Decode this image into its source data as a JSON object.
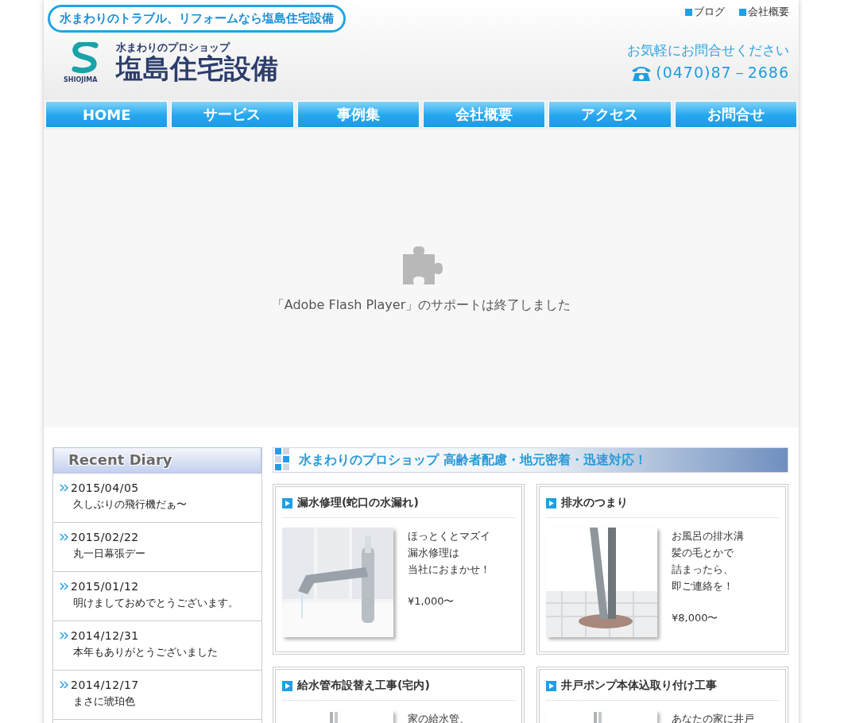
{
  "header": {
    "tagline": "水まわりのトラブル、リフォームなら塩島住宅設備",
    "logo": {
      "sub": "水まわりのプロショップ",
      "name": "塩島住宅設備",
      "roman": "SHIOJIMA"
    },
    "top_links": [
      "ブログ",
      "会社概要"
    ],
    "contact": {
      "prompt": "お気軽にお問合せください",
      "phone": "(0470)87－2686"
    }
  },
  "nav": [
    "HOME",
    "サービス",
    "事例集",
    "会社概要",
    "アクセス",
    "お問合せ"
  ],
  "flash": {
    "message": "「Adobe Flash Player」のサポートは終了しました"
  },
  "sidebar": {
    "title": "Recent Diary",
    "entries": [
      {
        "date": "2015/04/05",
        "title": "久しぶりの飛行機だぁ〜"
      },
      {
        "date": "2015/02/22",
        "title": "丸一日幕張デー"
      },
      {
        "date": "2015/01/12",
        "title": "明けましておめでとうございます。"
      },
      {
        "date": "2014/12/31",
        "title": "本年もありがとうございました"
      },
      {
        "date": "2014/12/17",
        "title": "まさに琥珀色"
      }
    ]
  },
  "banner": {
    "text": "水まわりのプロショップ 高齢者配慮・地元密着・迅速対応！"
  },
  "services": [
    {
      "title": "漏水修理(蛇口の水漏れ)",
      "lines": [
        "ほっとくとマズイ",
        "漏水修理は",
        "当社におまかせ！"
      ],
      "price": "¥1,000〜"
    },
    {
      "title": "排水のつまり",
      "lines": [
        "お風呂の排水溝",
        "髪の毛とかで",
        "詰まったら、",
        "即ご連絡を！"
      ],
      "price": "¥8,000〜"
    },
    {
      "title": "給水管布設替え工事(宅内)",
      "lines": [
        "家の給水管、"
      ]
    },
    {
      "title": "井戸ポンプ本体込取り付け工事",
      "lines": [
        "あなたの家に井戸"
      ]
    }
  ]
}
